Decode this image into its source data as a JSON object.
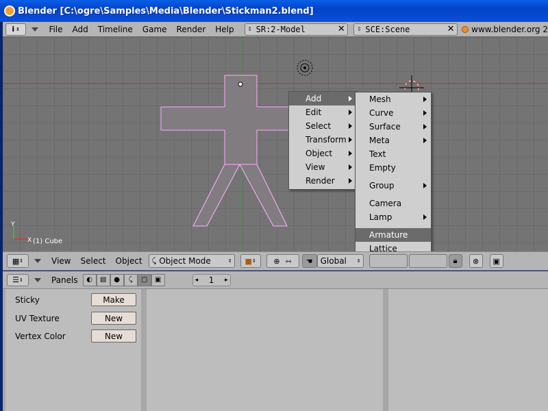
{
  "window": {
    "title": "Blender [C:\\ogre\\Samples\\Media\\Blender\\Stickman2.blend]"
  },
  "infobar": {
    "menus": [
      "File",
      "Add",
      "Timeline",
      "Game",
      "Render",
      "Help"
    ],
    "screen_field": "SR:2-Model",
    "scene_field": "SCE:Scene",
    "link": "www.blender.org 2"
  },
  "viewport": {
    "object_label": "(1) Cube",
    "axis_x": "X",
    "axis_y": "Y"
  },
  "main_menu": {
    "items": [
      {
        "label": "Add",
        "submenu": true,
        "highlighted": true
      },
      {
        "label": "Edit",
        "submenu": true
      },
      {
        "label": "Select",
        "submenu": true
      },
      {
        "label": "Transform",
        "submenu": true
      },
      {
        "label": "Object",
        "submenu": true
      },
      {
        "label": "View",
        "submenu": true
      },
      {
        "label": "Render",
        "submenu": true
      }
    ]
  },
  "add_menu": {
    "items": [
      {
        "label": "Mesh",
        "submenu": true
      },
      {
        "label": "Curve",
        "submenu": true
      },
      {
        "label": "Surface",
        "submenu": true
      },
      {
        "label": "Meta",
        "submenu": true
      },
      {
        "label": "Text"
      },
      {
        "label": "Empty"
      },
      {
        "label": "Group",
        "submenu": true
      },
      {
        "label": "Camera"
      },
      {
        "label": "Lamp",
        "submenu": true
      },
      {
        "label": "Armature",
        "highlighted": true
      },
      {
        "label": "Lattice"
      }
    ]
  },
  "header3d": {
    "menus": [
      "View",
      "Select",
      "Object"
    ],
    "mode": "Object Mode",
    "orientation": "Global"
  },
  "buttons_header": {
    "panels_label": "Panels",
    "frame": "1"
  },
  "mesh_panel": {
    "rows": [
      {
        "label": "Sticky",
        "button": "Make"
      },
      {
        "label": "UV Texture",
        "button": "New"
      },
      {
        "label": "Vertex Color",
        "button": "New"
      }
    ]
  },
  "colors": {
    "titlebar": "#0a50d8",
    "viewport_bg": "#747474",
    "mesh_fill": "#807c80",
    "mesh_outline": "#ffaaff",
    "menu_bg": "#cfcfcf",
    "menu_highlight": "#6b6b6b"
  }
}
